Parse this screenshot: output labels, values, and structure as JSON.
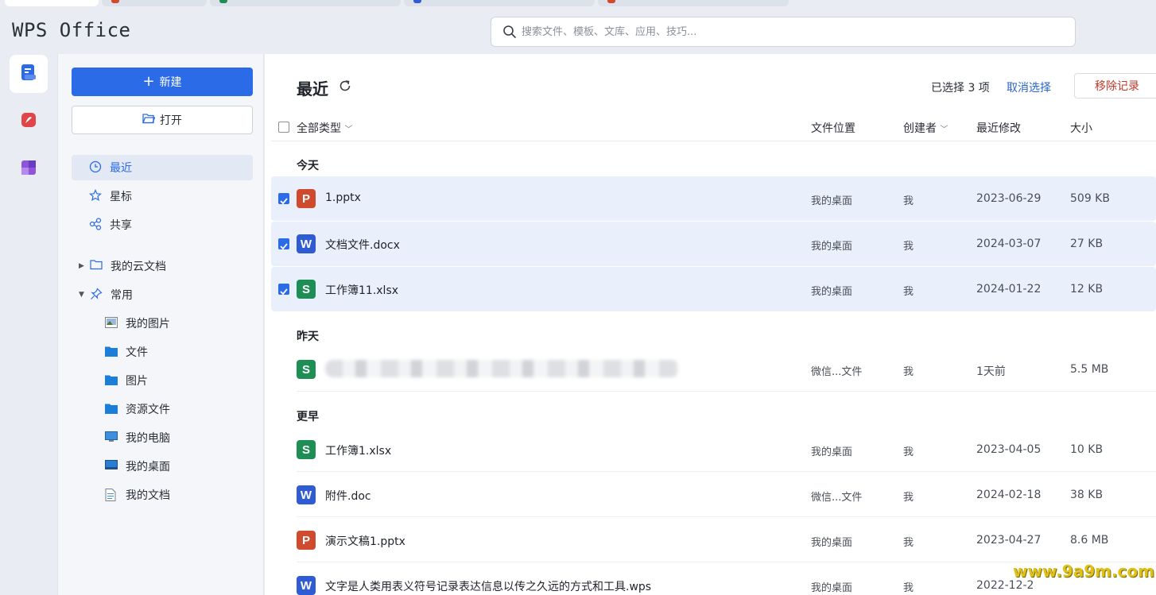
{
  "app": {
    "logo": "WPS Office"
  },
  "colors": {
    "accent": "#2b6be8",
    "ppt": "#d04a2d",
    "word": "#2f5bd3",
    "excel": "#1e8e55",
    "danger": "#c0392b"
  },
  "search": {
    "placeholder": "搜索文件、模板、文库、应用、技巧..."
  },
  "rail": {
    "items": [
      {
        "icon": "documents-icon",
        "active": true
      },
      {
        "icon": "pdf-icon",
        "active": false
      },
      {
        "icon": "apps-icon",
        "active": false
      }
    ]
  },
  "sidebar": {
    "new_label": "新建",
    "open_label": "打开",
    "nav": {
      "recent": "最近",
      "star": "星标",
      "share": "共享"
    },
    "tree": {
      "cloud_docs": "我的云文档",
      "common": "常用"
    },
    "common_items": {
      "pictures": "我的图片",
      "files": "文件",
      "images": "图片",
      "resources": "资源文件",
      "computer": "我的电脑",
      "desktop": "我的桌面",
      "documents": "我的文档"
    }
  },
  "main": {
    "title": "最近",
    "selected_text": "已选择 3 项",
    "cancel_select": "取消选择",
    "remove_label": "移除记录",
    "columns": {
      "type": "全部类型",
      "location": "文件位置",
      "creator": "创建者",
      "modified": "最近修改",
      "size": "大小"
    },
    "groups": {
      "today": "今天",
      "yesterday": "昨天",
      "earlier": "更早"
    },
    "today": [
      {
        "letter": "P",
        "name": "1.pptx",
        "location": "我的桌面",
        "creator": "我",
        "modified": "2023-06-29",
        "size": "509 KB"
      },
      {
        "letter": "W",
        "name": "文档文件.docx",
        "location": "我的桌面",
        "creator": "我",
        "modified": "2024-03-07",
        "size": "27 KB"
      },
      {
        "letter": "S",
        "name": "工作簿11.xlsx",
        "location": "我的桌面",
        "creator": "我",
        "modified": "2024-01-22",
        "size": "12 KB"
      }
    ],
    "yesterday": [
      {
        "letter": "S",
        "location": "微信...文件",
        "creator": "我",
        "modified": "1天前",
        "size": "5.5 MB"
      }
    ],
    "earlier": [
      {
        "letter": "S",
        "name": "工作簿1.xlsx",
        "location": "我的桌面",
        "creator": "我",
        "modified": "2023-04-05",
        "size": "10 KB"
      },
      {
        "letter": "W",
        "name": "附件.doc",
        "location": "微信...文件",
        "creator": "我",
        "modified": "2024-02-18",
        "size": "38 KB"
      },
      {
        "letter": "P",
        "name": "演示文稿1.pptx",
        "location": "我的桌面",
        "creator": "我",
        "modified": "2023-04-27",
        "size": "8.6 MB"
      },
      {
        "letter": "W",
        "name": "文字是人类用表义符号记录表达信息以传之久远的方式和工具.wps",
        "location": "我的桌面",
        "creator": "我",
        "modified": "2022-12-2",
        "size": ""
      }
    ]
  },
  "watermark": "www.9a9m.com"
}
